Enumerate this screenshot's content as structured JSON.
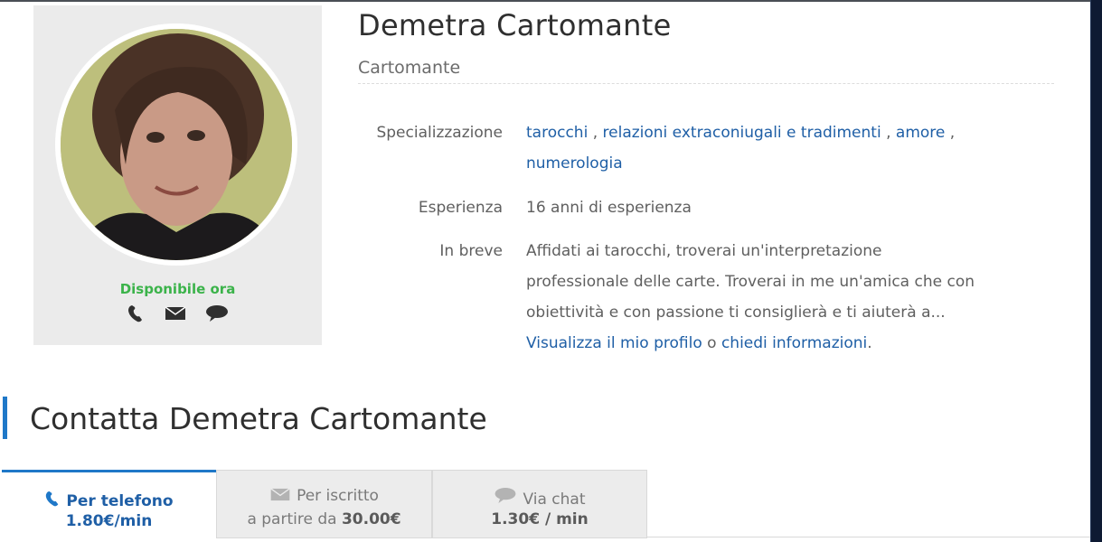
{
  "profile": {
    "name": "Demetra Cartomante",
    "role": "Cartomante",
    "status": "Disponibile ora",
    "contact_icons": [
      "phone-icon",
      "mail-icon",
      "chat-icon"
    ]
  },
  "details": {
    "specializzazione_label": "Specializzazione",
    "specializzazioni": [
      "tarocchi",
      "relazioni extraconiugali e tradimenti",
      "amore",
      "numerologia"
    ],
    "esperienza_label": "Esperienza",
    "esperienza_value": "16 anni di esperienza",
    "breve_label": "In breve",
    "breve_lines": [
      "Affidati ai tarocchi, troverai un'interpretazione",
      "professionale delle carte. Troverai in me un'amica che con",
      "obiettività e con passione ti consiglierà e ti aiuterà a..."
    ],
    "profile_link": "Visualizza il mio profilo",
    "or_text": "o",
    "info_link": "chiedi informazioni",
    "period": "."
  },
  "contact": {
    "title": "Contatta Demetra Cartomante",
    "tabs": [
      {
        "label": "Per telefono",
        "price": "1.80€/min",
        "icon": "phone-icon"
      },
      {
        "label": "Per iscritto",
        "price_prefix": "a partire da",
        "price": "30.00€",
        "icon": "mail-icon"
      },
      {
        "label": "Via chat",
        "price": "1.30€ / min",
        "icon": "chat-icon"
      }
    ]
  },
  "colors": {
    "link": "#1f5fa6",
    "accent": "#1f78c8",
    "available": "#3bb34a"
  }
}
